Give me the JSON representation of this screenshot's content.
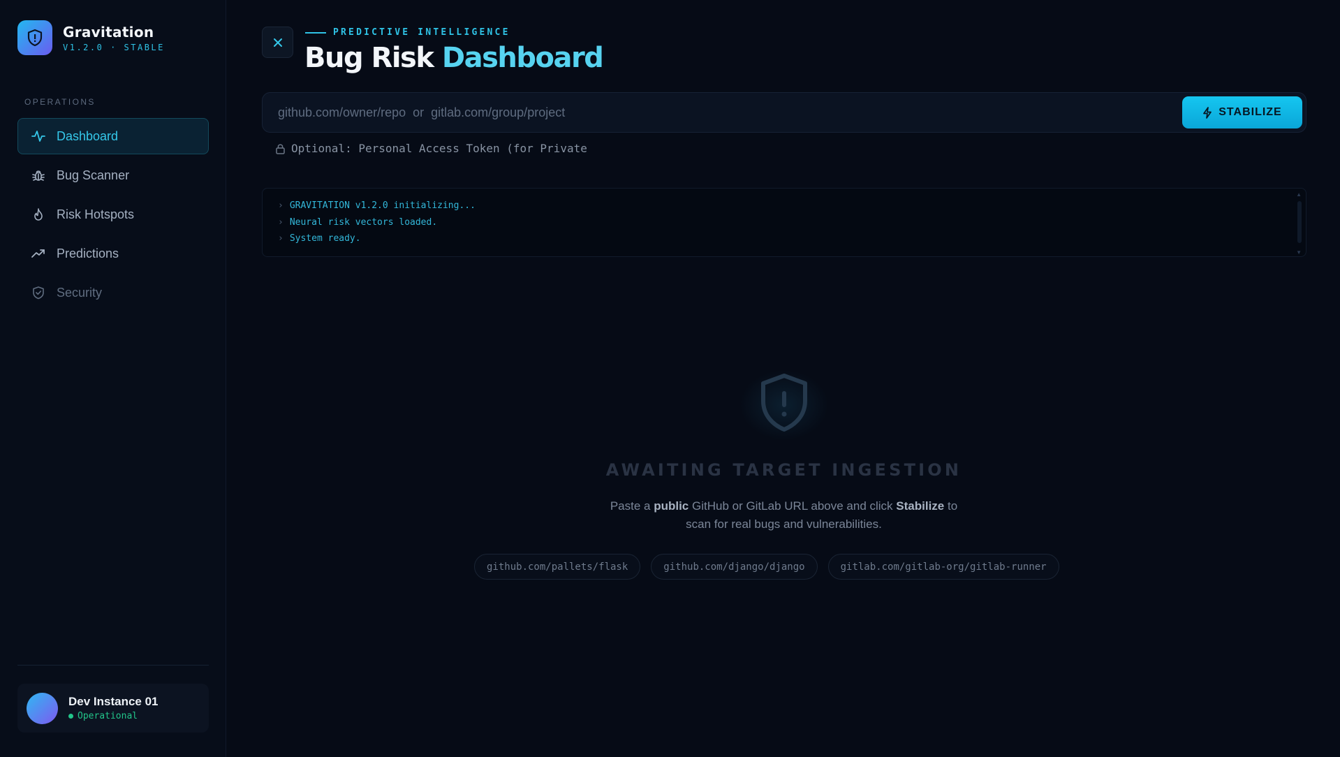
{
  "brand": {
    "name": "Gravitation",
    "version": "V1.2.0 · STABLE"
  },
  "sidebar": {
    "section_label": "OPERATIONS",
    "items": [
      {
        "label": "Dashboard",
        "icon": "activity-icon",
        "state": "active"
      },
      {
        "label": "Bug Scanner",
        "icon": "bug-icon",
        "state": "normal"
      },
      {
        "label": "Risk Hotspots",
        "icon": "flame-icon",
        "state": "normal"
      },
      {
        "label": "Predictions",
        "icon": "trending-up-icon",
        "state": "normal"
      },
      {
        "label": "Security",
        "icon": "shield-check-icon",
        "state": "muted"
      }
    ],
    "user": {
      "name": "Dev Instance 01",
      "status": "Operational"
    }
  },
  "header": {
    "eyebrow": "PREDICTIVE INTELLIGENCE",
    "title_main": "Bug Risk",
    "title_accent": "Dashboard"
  },
  "search": {
    "placeholder": "github.com/owner/repo  or  gitlab.com/group/project",
    "value": "",
    "button_label": "STABILIZE"
  },
  "token": {
    "placeholder": "Optional: Personal Access Token (for Private"
  },
  "console": {
    "lines": [
      "GRAVITATION v1.2.0 initializing...",
      "Neural risk vectors loaded.",
      "System ready."
    ]
  },
  "empty_state": {
    "title": "AWAITING TARGET INGESTION",
    "desc_1": "Paste a ",
    "desc_bold_1": "public",
    "desc_2": " GitHub or GitLab URL above and click ",
    "desc_bold_2": "Stabilize",
    "desc_3": " to scan for real bugs and vulnerabilities.",
    "examples": [
      "github.com/pallets/flask",
      "github.com/django/django",
      "gitlab.com/gitlab-org/gitlab-runner"
    ]
  },
  "colors": {
    "accent": "#2fc3e6",
    "background": "#060b16",
    "status_ok": "#22c48a"
  }
}
